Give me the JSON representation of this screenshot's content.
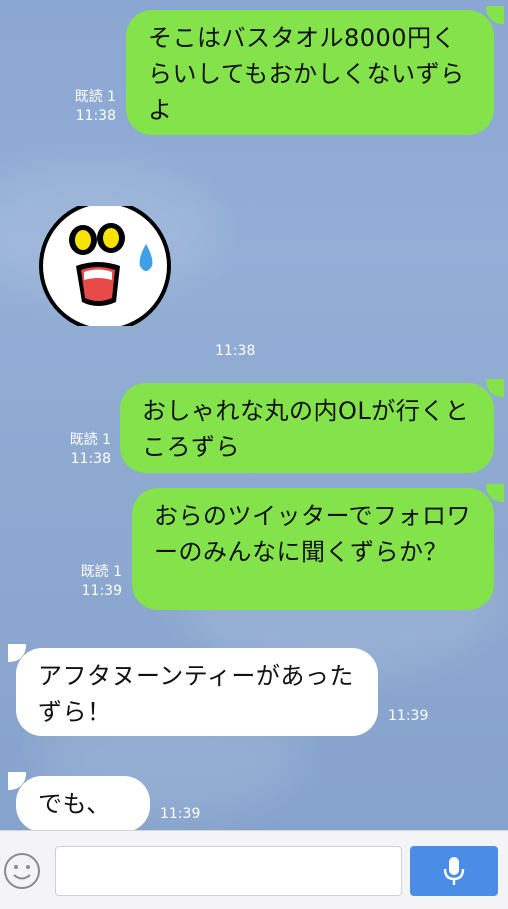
{
  "messages": [
    {
      "id": "m1",
      "direction": "out",
      "text": "そこはバスタオル8000円くらいしてもおかしくないずらよ",
      "read_label": "既読 1",
      "time": "11:38"
    },
    {
      "id": "sticker1",
      "direction": "in",
      "type": "sticker",
      "sticker_name": "shocked-face-sticker",
      "time": "11:38"
    },
    {
      "id": "m2",
      "direction": "out",
      "text": "おしゃれな丸の内OLが行くところずら",
      "read_label": "既読 1",
      "time": "11:38"
    },
    {
      "id": "m3",
      "direction": "out",
      "text": "おらのツイッターでフォロワーのみんなに聞くずらか？",
      "read_label": "既読 1",
      "time": "11:39"
    },
    {
      "id": "m4",
      "direction": "in",
      "text": "アフタヌーンティーがあったずら！",
      "time": "11:39"
    },
    {
      "id": "m5",
      "direction": "in",
      "text": "でも、",
      "time": "11:39"
    }
  ],
  "input": {
    "placeholder": "",
    "value": ""
  },
  "icons": {
    "emoji": "smiley-icon",
    "mic": "microphone-icon"
  },
  "colors": {
    "outgoing_bubble": "#84e34a",
    "incoming_bubble": "#ffffff",
    "send_button": "#4b8ce6",
    "background": "#8fa9cf"
  }
}
